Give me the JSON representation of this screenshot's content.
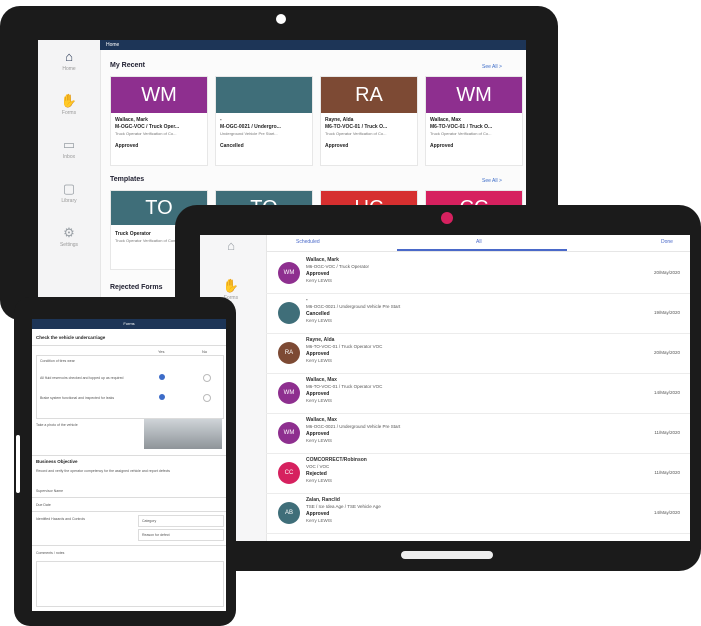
{
  "back_tablet": {
    "topbar_title": "Home",
    "nav": [
      {
        "icon": "home-icon",
        "glyph": "⌂",
        "label": "Home"
      },
      {
        "icon": "hand-icon",
        "glyph": "✋",
        "label": "Forms"
      },
      {
        "icon": "inbox-icon",
        "glyph": "▭",
        "label": "Inbox"
      },
      {
        "icon": "folder-icon",
        "glyph": "▢",
        "label": "Library"
      },
      {
        "icon": "settings-icon",
        "glyph": "⚙",
        "label": "Settings"
      }
    ],
    "my_recent": {
      "title": "My Recent",
      "see_all": "See All >",
      "cards": [
        {
          "initials": "WM",
          "color": "#8e2f8f",
          "name": "Wallace, Mark",
          "form": "M-OGC-VOC / Truck Oper...",
          "detail": "Truck Operator Verification of Co...",
          "status": "Approved"
        },
        {
          "initials": "",
          "color": "#3f6e79",
          "name": "-",
          "form": "M-OGC-0021 / Undergro...",
          "detail": "Underground Vehicle Pre Start...",
          "status": "Cancelled"
        },
        {
          "initials": "RA",
          "color": "#7d4a34",
          "name": "Rayne, Alda",
          "form": "M6-TO-VOC-01 / Truck O...",
          "detail": "Truck Operator Verification of Co...",
          "status": "Approved"
        },
        {
          "initials": "WM",
          "color": "#8e2f8f",
          "name": "Wallace, Max",
          "form": "M6-TO-VOC-01 / Truck O...",
          "detail": "Truck Operator Verification of Co...",
          "status": "Approved"
        }
      ]
    },
    "templates": {
      "title": "Templates",
      "see_all": "See All >",
      "cards": [
        {
          "initials": "TO",
          "color": "#3f6e79",
          "name": "Truck Operator",
          "detail": "Truck Operator Verification of Competency"
        },
        {
          "initials": "TO",
          "color": "#3f6e79",
          "name": "",
          "detail": ""
        },
        {
          "initials": "UC",
          "color": "#d62f2f",
          "name": "",
          "detail": ""
        },
        {
          "initials": "CC",
          "color": "#d6215f",
          "name": "",
          "detail": ""
        }
      ]
    },
    "rejected_title": "Rejected Forms"
  },
  "front_tablet": {
    "tabs": [
      "Scheduled",
      "All",
      "Done"
    ],
    "nav_label": "Forms",
    "rows": [
      {
        "initials": "WM",
        "color": "#8e2f8f",
        "name": "Wallace, Mark",
        "form": "M6-OGC-VOC / Truck Operator",
        "status": "Approved",
        "owner": "Kerry LEWIS",
        "date": "20/May/2020"
      },
      {
        "initials": "",
        "color": "#3f6e79",
        "name": "-",
        "form": "M6-OGC-0021 / Underground Vehicle Pre Start",
        "status": "Cancelled",
        "owner": "Kerry LEWIS",
        "date": "19/May/2020"
      },
      {
        "initials": "RA",
        "color": "#7d4a34",
        "name": "Rayne, Alda",
        "form": "M6-TO-VOC-01 / Truck Operator VOC",
        "status": "Approved",
        "owner": "Kerry LEWIS",
        "date": "20/May/2020"
      },
      {
        "initials": "WM",
        "color": "#8e2f8f",
        "name": "Wallace, Max",
        "form": "M6-TO-VOC-01 / Truck Operator VOC",
        "status": "Approved",
        "owner": "Kerry LEWIS",
        "date": "14/May/2020"
      },
      {
        "initials": "WM",
        "color": "#8e2f8f",
        "name": "Wallace, Max",
        "form": "M6-OGC-0021 / Underground Vehicle Pre Start",
        "status": "Approved",
        "owner": "Kerry LEWIS",
        "date": "11/May/2020"
      },
      {
        "initials": "CC",
        "color": "#d6215f",
        "name": "COMCORRECT/Robinson",
        "form": "VOC / VOC",
        "status": "Rejected",
        "owner": "Kerry LEWIS",
        "date": "11/May/2020"
      },
      {
        "initials": "AB",
        "color": "#3f6e79",
        "name": "Zalan, Ranclid",
        "form": "TSE / Ice Idea Age / TSE Vehicle Age",
        "status": "Approved",
        "owner": "Kerry LEWIS",
        "date": "14/May/2020"
      }
    ]
  },
  "small_tablet": {
    "header": "Forms",
    "section1": "Check the vehicle undercarriage",
    "col_yes": "Yes",
    "col_no": "No",
    "q1": "Condition of tires wear",
    "q2": "All fluid reservoirs checked and topped up as required",
    "q3": "Brake system functional and inspected for leaks",
    "photo_label": "Take a photo of the vehicle",
    "section2": "Business Objective",
    "b1": "Record and verify the operator competency for the assigned vehicle and report defects",
    "f1": "Supervisor Name",
    "f2": "Due Date",
    "f3": "Identified Hazards and Controls",
    "opt1": "Category",
    "opt2": "Reason for defect",
    "f4": "Comments / notes"
  },
  "colors": {
    "navy": "#1d3557",
    "accent": "#d6215f",
    "link": "#4a69c9"
  }
}
